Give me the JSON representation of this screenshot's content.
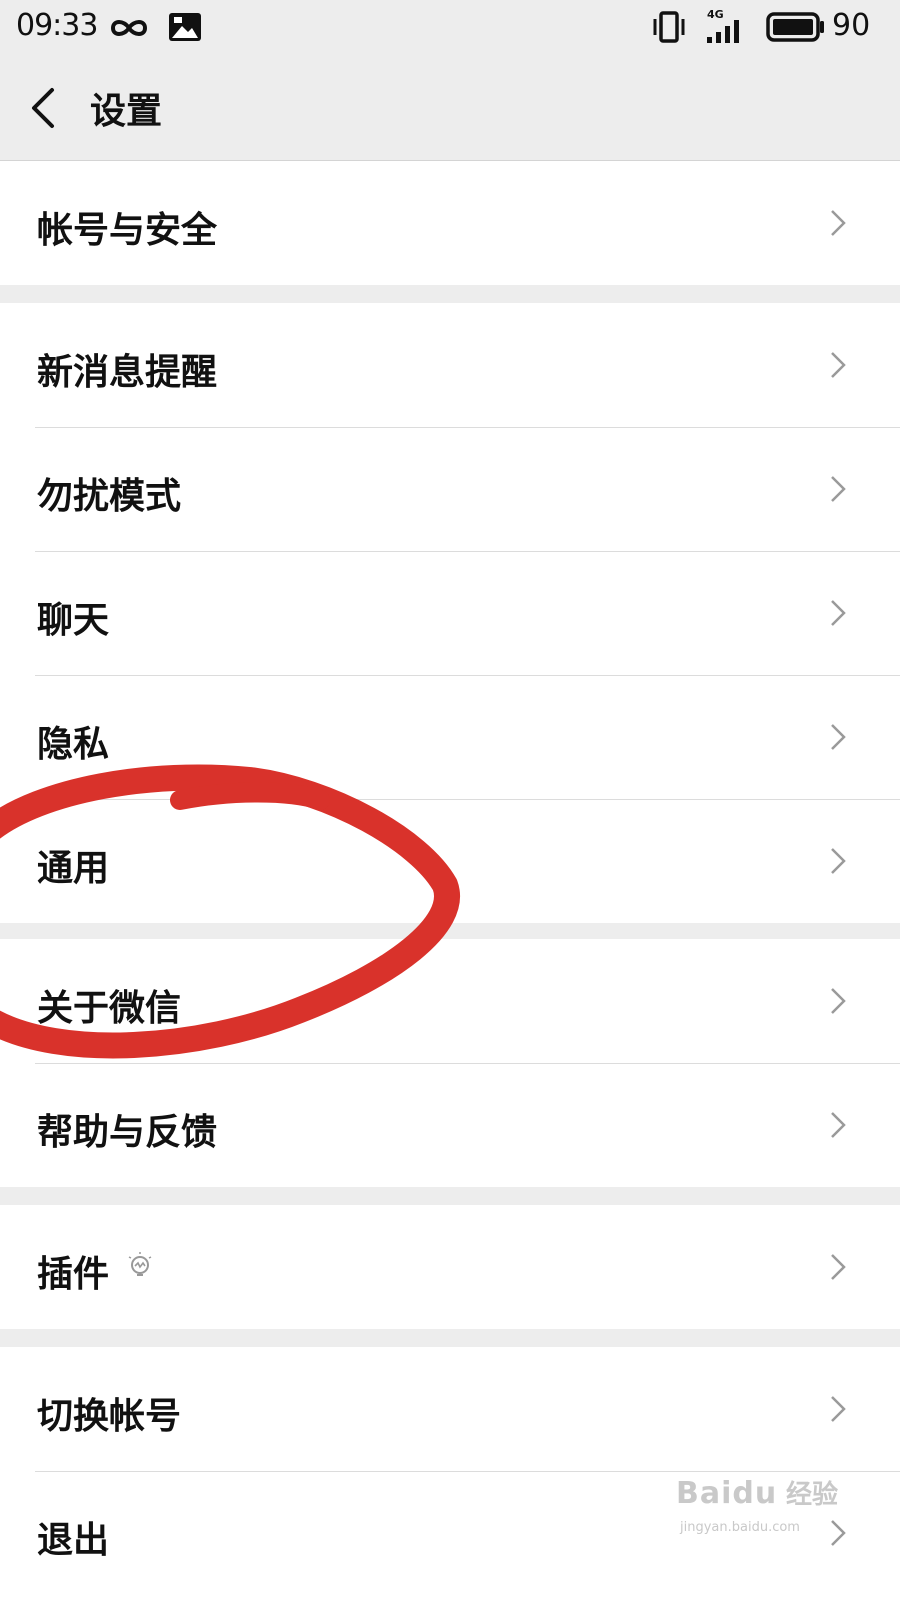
{
  "status_bar": {
    "time": "09:33",
    "battery": "90",
    "network": "4G",
    "icons": [
      "infinity-icon",
      "image-notification-icon",
      "vibrate-icon",
      "signal-icon",
      "battery-icon"
    ]
  },
  "header": {
    "title": "设置"
  },
  "groups": [
    {
      "items": [
        {
          "label": "帐号与安全"
        }
      ]
    },
    {
      "items": [
        {
          "label": "新消息提醒"
        },
        {
          "label": "勿扰模式"
        },
        {
          "label": "聊天"
        },
        {
          "label": "隐私"
        },
        {
          "label": "通用"
        }
      ]
    },
    {
      "items": [
        {
          "label": "关于微信"
        },
        {
          "label": "帮助与反馈"
        }
      ]
    },
    {
      "items": [
        {
          "label": "插件",
          "icon": "lightbulb-icon"
        }
      ]
    },
    {
      "items": [
        {
          "label": "切换帐号"
        },
        {
          "label": "退出"
        }
      ]
    }
  ],
  "annotation": {
    "color": "#d9322b",
    "highlights": "通用"
  },
  "watermark": {
    "logo": "Baidu",
    "text": "经验",
    "url": "jingyan.baidu.com"
  }
}
